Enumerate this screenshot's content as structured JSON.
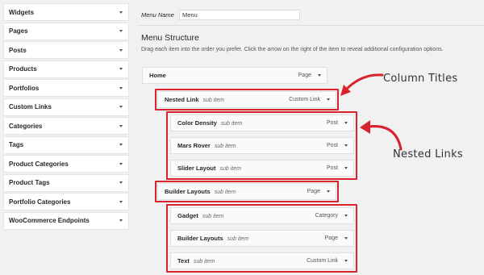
{
  "sidebar": {
    "items": [
      {
        "label": "Widgets"
      },
      {
        "label": "Pages"
      },
      {
        "label": "Posts"
      },
      {
        "label": "Products"
      },
      {
        "label": "Portfolios"
      },
      {
        "label": "Custom Links"
      },
      {
        "label": "Categories"
      },
      {
        "label": "Tags"
      },
      {
        "label": "Product Categories"
      },
      {
        "label": "Product Tags"
      },
      {
        "label": "Portfolio Categories"
      },
      {
        "label": "WooCommerce Endpoints"
      }
    ]
  },
  "menu_name": {
    "label": "Menu Name",
    "value": "Menu"
  },
  "structure": {
    "title": "Menu Structure",
    "description": "Drag each item into the order you prefer. Click the arrow on the right of the item to reveal additional configuration options."
  },
  "items": [
    {
      "title": "Home",
      "sub": "",
      "type": "Page"
    },
    {
      "title": "Nested Link",
      "sub": "sub item",
      "type": "Custom Link"
    },
    {
      "title": "Color Density",
      "sub": "sub item",
      "type": "Post"
    },
    {
      "title": "Mars Rover",
      "sub": "sub item",
      "type": "Post"
    },
    {
      "title": "Slider Layout",
      "sub": "sub item",
      "type": "Post"
    },
    {
      "title": "Builder Layouts",
      "sub": "sub item",
      "type": "Page"
    },
    {
      "title": "Gadget",
      "sub": "sub item",
      "type": "Category"
    },
    {
      "title": "Builder Layouts",
      "sub": "sub item",
      "type": "Page"
    },
    {
      "title": "Text",
      "sub": "sub item",
      "type": "Custom Link"
    }
  ],
  "annotations": {
    "column_titles": "Column Titles",
    "nested_links": "Nested Links",
    "color": "#d7232e"
  },
  "icons": {
    "item_toggle": "triangle-down-icon",
    "annotation_arrow": "curved-arrow-icon"
  }
}
